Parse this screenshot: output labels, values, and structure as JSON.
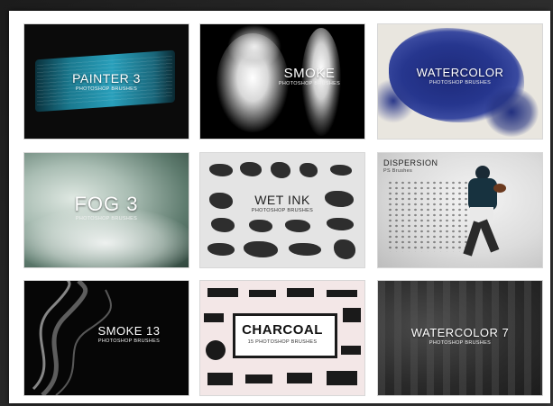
{
  "tiles": [
    {
      "title": "PAINTER 3",
      "subtitle": "PHOTOSHOP BRUSHES"
    },
    {
      "title": "SMOKE",
      "subtitle": "PHOTOSHOP BRUSHES"
    },
    {
      "title": "WATERCOLOR",
      "subtitle": "PHOTOSHOP BRUSHES"
    },
    {
      "title": "FOG 3",
      "subtitle": "PHOTOSHOP BRUSHES"
    },
    {
      "title": "WET INK",
      "subtitle": "PHOTOSHOP BRUSHES"
    },
    {
      "title": "DISPERSION",
      "subtitle": "PS Brushes"
    },
    {
      "title": "SMOKE 13",
      "subtitle": "PHOTOSHOP BRUSHES"
    },
    {
      "title": "CHARCOAL",
      "subtitle": "15 PHOTOSHOP BRUSHES"
    },
    {
      "title": "WATERCOLOR 7",
      "subtitle": "PHOTOSHOP BRUSHES"
    }
  ]
}
